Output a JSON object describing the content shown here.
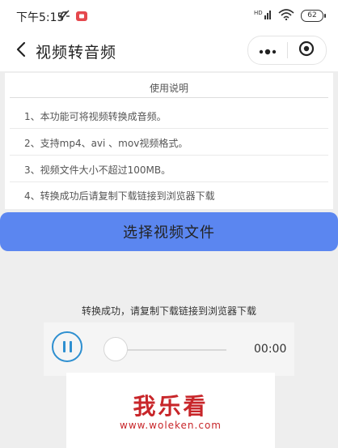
{
  "status_bar": {
    "time": "下午5:15",
    "battery": "62",
    "icons": [
      "mute-icon",
      "record-icon",
      "hd-icon",
      "signal-icon",
      "wifi-icon",
      "battery-icon"
    ]
  },
  "nav": {
    "title": "视频转音频",
    "icons": [
      "chevron-left-icon",
      "more-icon",
      "close-target-icon"
    ]
  },
  "instructions": {
    "title": "使用说明",
    "items": [
      "1、本功能可将视频转换成音频。",
      "2、支持mp4、avi 、mov视频格式。",
      "3、视频文件大小不超过100MB。",
      "4、转换成功后请复制下载链接到浏览器下载"
    ]
  },
  "select_button_label": "选择视频文件",
  "result": {
    "message": "转换成功，请复制下载链接到浏览器下载"
  },
  "player": {
    "time": "00:00",
    "progress": 0,
    "state_icon": "pause-icon"
  },
  "watermark": {
    "text": "我乐看",
    "url": "www.woleken.com"
  },
  "colors": {
    "primary_button": "#5b86f0",
    "player_accent": "#2e8fd0",
    "watermark": "#c8262a"
  }
}
